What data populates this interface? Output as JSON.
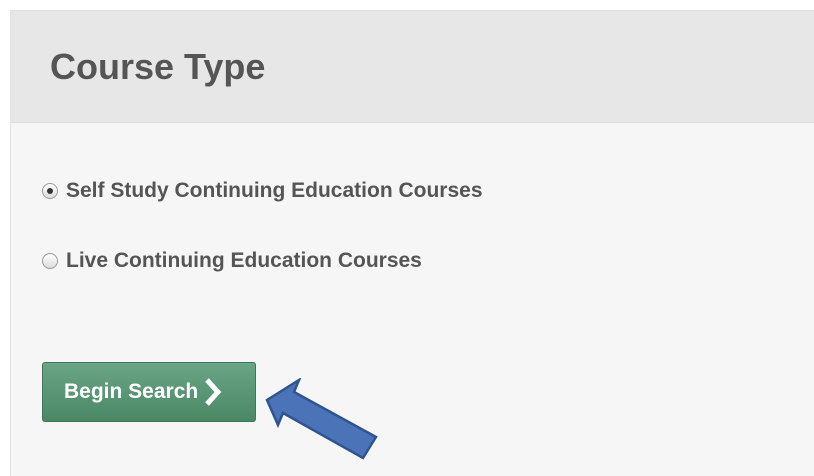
{
  "panel": {
    "title": "Course Type"
  },
  "options": [
    {
      "label": "Self Study Continuing Education Courses",
      "checked": true
    },
    {
      "label": "Live Continuing Education Courses",
      "checked": false
    }
  ],
  "search_button": {
    "label": "Begin Search",
    "icon": "chevron-right-icon"
  },
  "annotation": {
    "icon": "arrow-pointer-icon",
    "color": "#4a73b8"
  },
  "colors": {
    "button_green": "#5a9876",
    "title_gray": "#555555",
    "header_bg": "#e7e7e7",
    "panel_bg": "#f6f6f6"
  }
}
